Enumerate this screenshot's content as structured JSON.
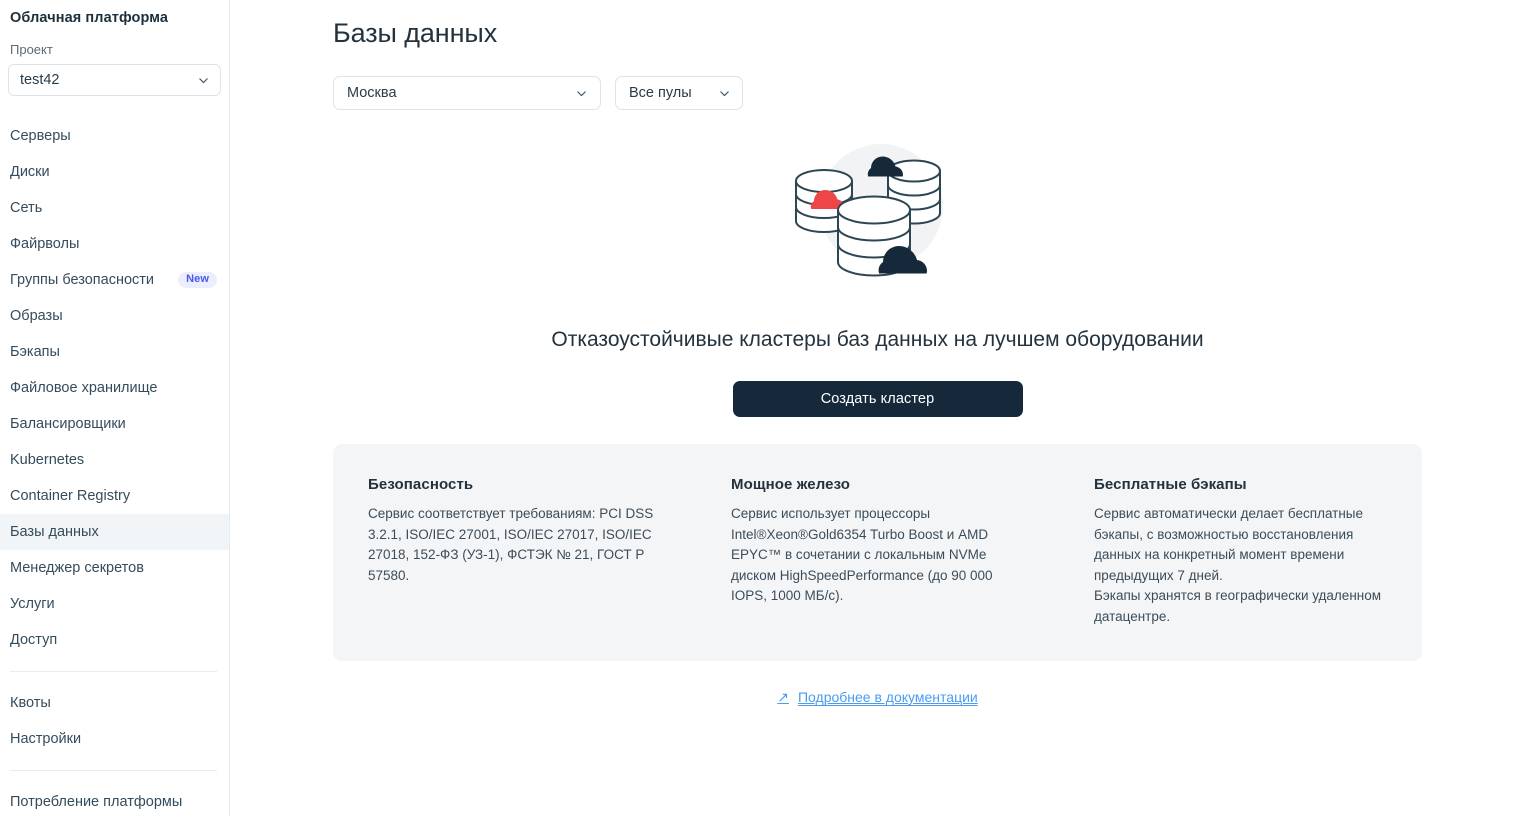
{
  "sidebar": {
    "brand": "Облачная платформа",
    "project_label": "Проект",
    "project_value": "test42",
    "groups": [
      {
        "items": [
          {
            "label": "Серверы"
          },
          {
            "label": "Диски"
          },
          {
            "label": "Сеть"
          },
          {
            "label": "Файрволы"
          },
          {
            "label": "Группы безопасности",
            "badge": "New"
          },
          {
            "label": "Образы"
          },
          {
            "label": "Бэкапы"
          },
          {
            "label": "Файловое хранилище"
          },
          {
            "label": "Балансировщики"
          },
          {
            "label": "Kubernetes"
          },
          {
            "label": "Container Registry"
          },
          {
            "label": "Базы данных",
            "active": true
          },
          {
            "label": "Менеджер секретов"
          },
          {
            "label": "Услуги"
          },
          {
            "label": "Доступ"
          }
        ]
      },
      {
        "items": [
          {
            "label": "Квоты"
          },
          {
            "label": "Настройки"
          }
        ]
      },
      {
        "items": [
          {
            "label": "Потребление платформы"
          }
        ]
      }
    ]
  },
  "page": {
    "title": "Базы данных"
  },
  "filters": {
    "region": {
      "value": "Москва",
      "icon": "chevron-down-icon"
    },
    "pool": {
      "value": "Все пулы",
      "icon": "chevron-down-icon"
    }
  },
  "hero": {
    "illustration": "databases-clouds-illustration",
    "title": "Отказоустойчивые кластеры баз данных\nна лучшем оборудовании",
    "cta_label": "Создать кластер"
  },
  "features": [
    {
      "title": "Безопасность",
      "text": "Сервис соответствует требованиям: PCI DSS 3.2.1, ISO/IEC 27001, ISO/IEC 27017, ISO/IEC 27018, 152-ФЗ (УЗ-1), ФСТЭК № 21, ГОСТ Р 57580."
    },
    {
      "title": "Мощное железо",
      "text": "Сервис использует процессоры Intel®Xeon®Gold6354 Turbo Boost и AMD EPYC™ в сочетании с локальным NVMe диском HighSpeedPerformance (до 90 000 IOPS, 1000 МБ/с)."
    },
    {
      "title": "Бесплатные бэкапы",
      "text": "Сервис автоматически делает бесплатные бэкапы, с возможностью восстановления данных на конкретный момент времени предыдущих 7 дней.\nБэкапы хранятся в географически удаленном датацентре."
    }
  ],
  "doc_link": {
    "icon": "arrow-up-right-icon",
    "label": "Подробнее в документации"
  },
  "colors": {
    "accent_link": "#4a9cf0",
    "cta_background": "#16293a",
    "badge_text": "#4a5ae8",
    "badge_background": "#eceefd",
    "card_background": "#f4f5f7",
    "illustration_dark": "#16293a",
    "illustration_stroke": "#2d4654",
    "illustration_red": "#ee4646",
    "illustration_circle": "#f2f3f4"
  }
}
